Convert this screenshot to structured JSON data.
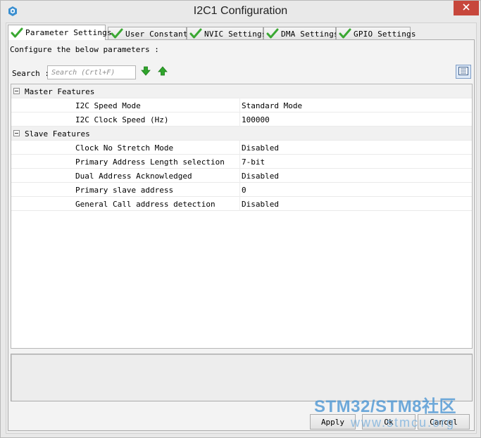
{
  "window": {
    "title": "I2C1 Configuration",
    "icon": "stm32cube-icon",
    "close": "close-icon"
  },
  "tabs": [
    {
      "label": "Parameter Settings",
      "active": true,
      "icon": "green-check-icon"
    },
    {
      "label": "User Constants",
      "active": false,
      "icon": "green-check-icon"
    },
    {
      "label": "NVIC Settings",
      "active": false,
      "icon": "green-check-icon"
    },
    {
      "label": "DMA Settings",
      "active": false,
      "icon": "green-check-icon"
    },
    {
      "label": "GPIO Settings",
      "active": false,
      "icon": "green-check-icon"
    }
  ],
  "instruction": "Configure the below parameters :",
  "search": {
    "label": "Search :",
    "placeholder": "Search (Crtl+F)",
    "down_icon": "arrow-down-icon",
    "up_icon": "arrow-up-icon",
    "view_icon": "list-view-icon"
  },
  "groups": [
    {
      "label": "Master Features",
      "params": [
        {
          "name": "I2C Speed Mode",
          "value": "Standard Mode"
        },
        {
          "name": "I2C Clock Speed (Hz)",
          "value": "100000"
        }
      ]
    },
    {
      "label": "Slave Features",
      "params": [
        {
          "name": "Clock No Stretch Mode",
          "value": "Disabled"
        },
        {
          "name": "Primary Address Length selection",
          "value": "7-bit"
        },
        {
          "name": "Dual Address Acknowledged",
          "value": "Disabled"
        },
        {
          "name": "Primary slave address",
          "value": "0"
        },
        {
          "name": "General Call address detection",
          "value": "Disabled"
        }
      ]
    }
  ],
  "buttons": {
    "apply": "Apply",
    "ok": "Ok",
    "cancel": "Cancel"
  },
  "watermark": {
    "line1": "STM32/STM8社区",
    "line2": "www.stmcu.org"
  },
  "colors": {
    "check_green": "#3aa832",
    "arrow_green": "#2fa52b",
    "close_red": "#c7473c",
    "view_button_border": "#7e9dc6"
  }
}
